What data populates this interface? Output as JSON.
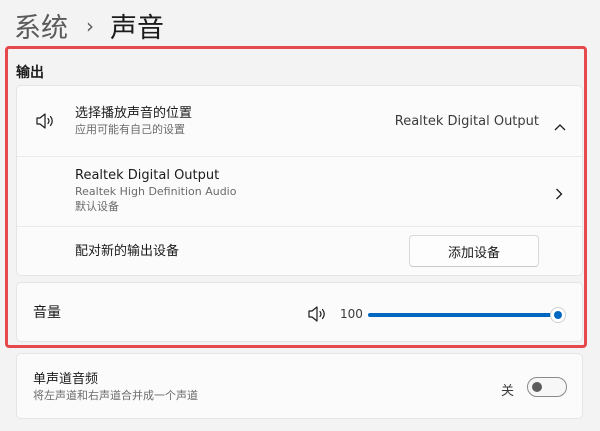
{
  "breadcrumb": {
    "parent": "系统",
    "separator": "›",
    "current": "声音"
  },
  "output": {
    "section_title": "输出",
    "choose_device": {
      "title": "选择播放声音的位置",
      "subtitle": "应用可能有自己的设置",
      "selected": "Realtek Digital Output",
      "icon": "speaker-icon",
      "expand_icon": "chevron-up-icon"
    },
    "device": {
      "name": "Realtek Digital Output",
      "description": "Realtek High Definition Audio",
      "status": "默认设备",
      "icon": "chevron-right-icon"
    },
    "pair": {
      "label": "配对新的输出设备",
      "button": "添加设备"
    },
    "volume": {
      "label": "音量",
      "value": "100",
      "level": 1.0,
      "icon": "speaker-volume-icon"
    }
  },
  "mono": {
    "title": "单声道音频",
    "subtitle": "将左声道和右声道合并成一个声道",
    "state_label": "关",
    "on": false
  },
  "colors": {
    "accent": "#0067c0",
    "highlight": "#e5484d"
  }
}
